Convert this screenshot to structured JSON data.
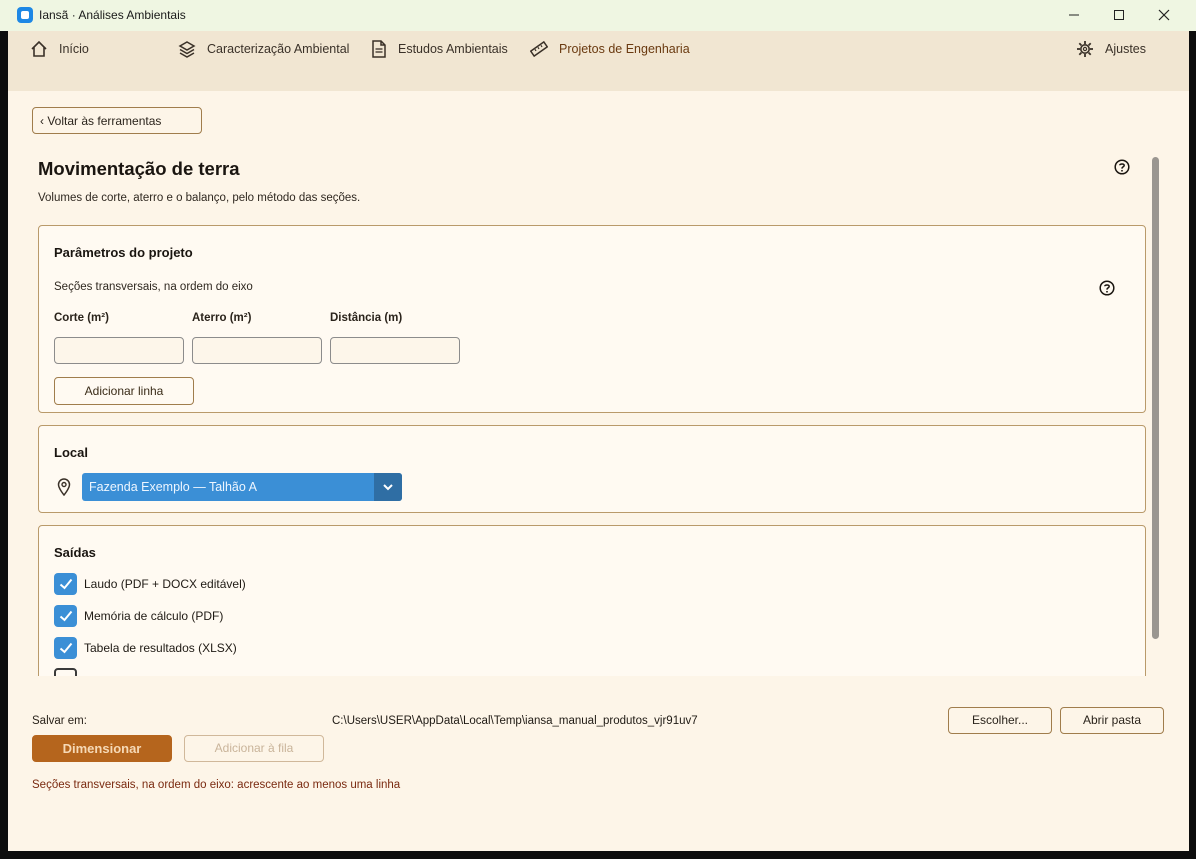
{
  "window": {
    "title": "Iansã · Análises Ambientais"
  },
  "nav": {
    "inicio": "Início",
    "caracterizacao": "Caracterização Ambiental",
    "estudos": "Estudos Ambientais",
    "projetos": "Projetos de Engenharia",
    "ajustes": "Ajustes"
  },
  "back_label": "‹ Voltar às ferramentas",
  "page": {
    "title": "Movimentação de terra",
    "subtitle": "Volumes de corte, aterro e o balanço, pelo método das seções."
  },
  "params": {
    "title": "Parâmetros do projeto",
    "sections_label": "Seções transversais, na ordem do eixo",
    "columns": [
      "Corte (m²)",
      "Aterro (m²)",
      "Distância (m)"
    ],
    "add_row": "Adicionar linha"
  },
  "local": {
    "title": "Local",
    "selected": "Fazenda Exemplo — Talhão A"
  },
  "outputs": {
    "title": "Saídas",
    "items": [
      {
        "label": "Laudo (PDF + DOCX editável)",
        "checked": true
      },
      {
        "label": "Memória de cálculo (PDF)",
        "checked": true
      },
      {
        "label": "Tabela de resultados (XLSX)",
        "checked": true
      },
      {
        "label": "",
        "checked": false
      }
    ]
  },
  "footer": {
    "save_label": "Salvar em:",
    "save_path": "C:\\Users\\USER\\AppData\\Local\\Temp\\iansa_manual_produtos_vjr91uv7",
    "choose": "Escolher...",
    "open_folder": "Abrir pasta",
    "dimension": "Dimensionar",
    "queue": "Adicionar à fila",
    "error": "Seções transversais, na ordem do eixo: acrescente ao menos uma linha"
  },
  "colors": {
    "accent": "#3b8fd6",
    "primary": "#b5651d",
    "border": "#b99a6a"
  }
}
